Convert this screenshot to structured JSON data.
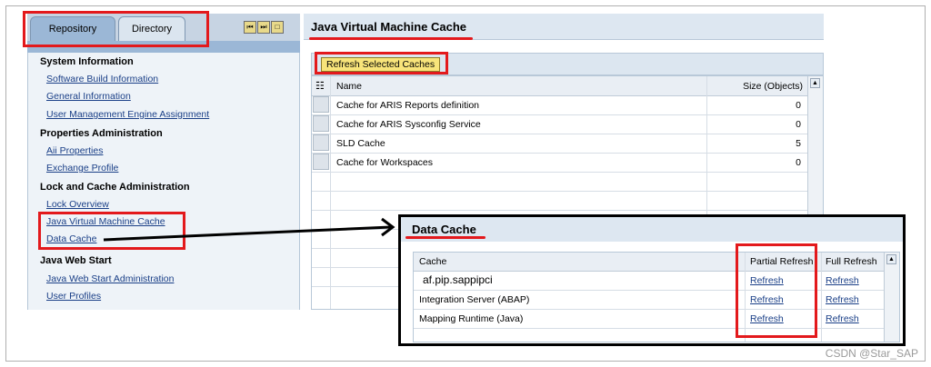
{
  "left_panel": {
    "tabs": [
      {
        "label": "Repository"
      },
      {
        "label": "Directory"
      }
    ],
    "nav_buttons": [
      "⏮",
      "⏭",
      "□"
    ],
    "sections": [
      {
        "title": "System Information",
        "links": [
          "Software Build Information",
          "General Information",
          "User Management Engine Assignment"
        ]
      },
      {
        "title": "Properties Administration",
        "links": [
          "Aii Properties",
          "Exchange Profile"
        ]
      },
      {
        "title": "Lock and Cache Administration",
        "links": [
          "Lock Overview",
          "Java Virtual Machine Cache",
          "Data Cache"
        ]
      },
      {
        "title": "Java Web Start",
        "links": [
          "Java Web Start Administration",
          "User Profiles"
        ]
      }
    ]
  },
  "jvm_cache": {
    "title": "Java Virtual Machine Cache",
    "refresh_button": "Refresh Selected Caches",
    "columns": [
      "Name",
      "Size (Objects)"
    ],
    "rows": [
      {
        "name": "Cache for ARIS Reports definition",
        "size": "0"
      },
      {
        "name": "Cache for ARIS Sysconfig Service",
        "size": "0"
      },
      {
        "name": "SLD Cache",
        "size": "5"
      },
      {
        "name": "Cache for Workspaces",
        "size": "0"
      }
    ]
  },
  "data_cache": {
    "title": "Data Cache",
    "columns": [
      "Cache",
      "Partial Refresh",
      "Full Refresh"
    ],
    "rows": [
      {
        "cache": "af.pip.sappipci",
        "partial": "Refresh",
        "full": "Refresh"
      },
      {
        "cache": "Integration Server (ABAP)",
        "partial": "Refresh",
        "full": "Refresh"
      },
      {
        "cache": "Mapping Runtime (Java)",
        "partial": "Refresh",
        "full": "Refresh"
      }
    ]
  },
  "watermark": "CSDN @Star_SAP",
  "colors": {
    "annotation_red": "#e3191c",
    "link_blue": "#1a3f87",
    "button_yellow": "#f8e47a"
  }
}
